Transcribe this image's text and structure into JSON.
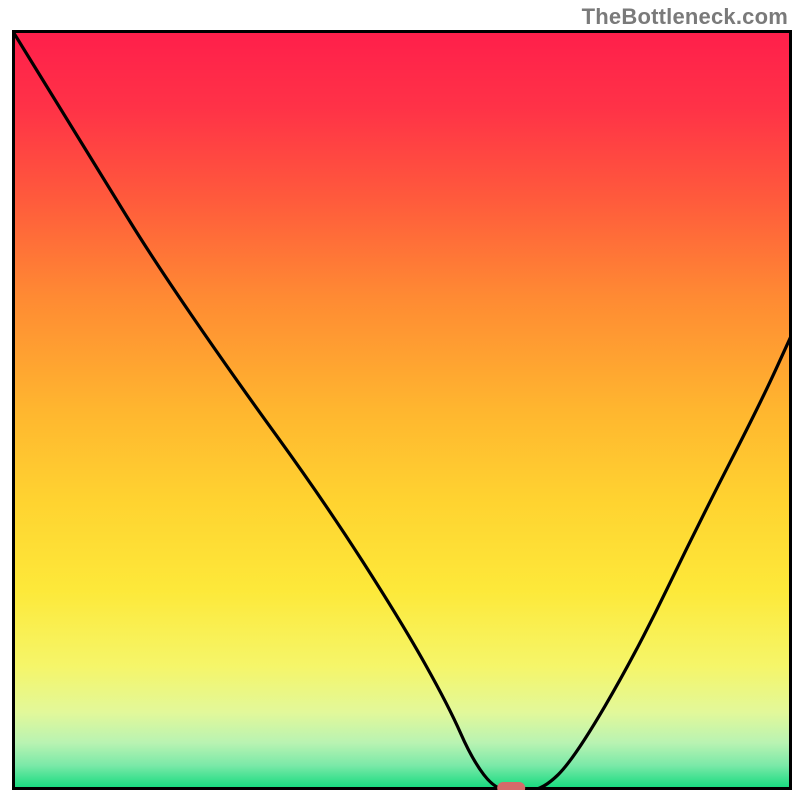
{
  "watermark": "TheBottleneck.com",
  "chart_data": {
    "type": "line",
    "title": "",
    "xlabel": "",
    "ylabel": "",
    "xlim": [
      0,
      100
    ],
    "ylim": [
      0,
      100
    ],
    "grid": false,
    "series": [
      {
        "name": "curve",
        "x": [
          0,
          6,
          12,
          18,
          28,
          40,
          50,
          56,
          59,
          62,
          65,
          68,
          72,
          80,
          88,
          96,
          100
        ],
        "y": [
          100,
          90,
          80,
          70,
          55,
          38,
          22,
          11,
          4,
          0,
          0,
          0,
          4,
          18,
          35,
          51,
          60
        ]
      }
    ],
    "marker": {
      "x": 64,
      "y": 0
    },
    "background_gradient": {
      "stops": [
        {
          "pos": 0.0,
          "color": "#ff1f4b"
        },
        {
          "pos": 0.1,
          "color": "#ff3247"
        },
        {
          "pos": 0.22,
          "color": "#ff5a3c"
        },
        {
          "pos": 0.35,
          "color": "#ff8a33"
        },
        {
          "pos": 0.5,
          "color": "#ffb62f"
        },
        {
          "pos": 0.62,
          "color": "#ffd330"
        },
        {
          "pos": 0.74,
          "color": "#fde93a"
        },
        {
          "pos": 0.84,
          "color": "#f5f66a"
        },
        {
          "pos": 0.9,
          "color": "#e2f89a"
        },
        {
          "pos": 0.94,
          "color": "#b9f3b2"
        },
        {
          "pos": 0.97,
          "color": "#7be9a8"
        },
        {
          "pos": 1.0,
          "color": "#16db7f"
        }
      ]
    },
    "colors": {
      "curve": "#000000",
      "marker": "#d66a6a",
      "plot_border": "#000000"
    }
  }
}
